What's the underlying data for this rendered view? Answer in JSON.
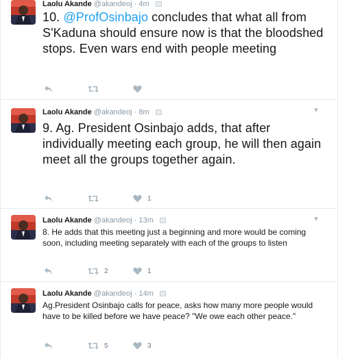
{
  "tweets": [
    {
      "name": "Laolu Akande",
      "handle": "@akandeoj",
      "time": "· 4m",
      "text_prefix": "10. ",
      "mention": "@ProfOsinbajo",
      "text_suffix": " concludes that what all from S'Kaduna should ensure now is that the bloodshed stops. Even wars end with people meeting",
      "retweets": "",
      "likes": ""
    },
    {
      "name": "Laolu Akande",
      "handle": "@akandeoj",
      "time": "· 8m",
      "text": "9. Ag. President Osinbajo adds, that after individually meeting each group, he will then again meet all the groups together again.",
      "retweets": "",
      "likes": "1"
    },
    {
      "name": "Laolu Akande",
      "handle": "@akandeoj",
      "time": "· 13m",
      "text": "8. He adds that this meeting just a beginning and more would be coming soon, including meeting separately with each of the groups to listen",
      "retweets": "2",
      "likes": "1"
    },
    {
      "name": "Laolu Akande",
      "handle": "@akandeoj",
      "time": "· 14m",
      "text": "Ag.President Osinbajo calls for peace, asks how many more people would have to be killed before we have peace? \"We owe each other peace.\"",
      "retweets": "5",
      "likes": "3"
    }
  ],
  "icons": {
    "reply": "reply-icon",
    "retweet": "retweet-icon",
    "like": "heart-icon",
    "more": "chevron-down-icon",
    "verified": "verified-icon"
  },
  "colors": {
    "mention": "#1da1f2",
    "meta": "#8899a6",
    "action_icon": "#aab8c2"
  }
}
